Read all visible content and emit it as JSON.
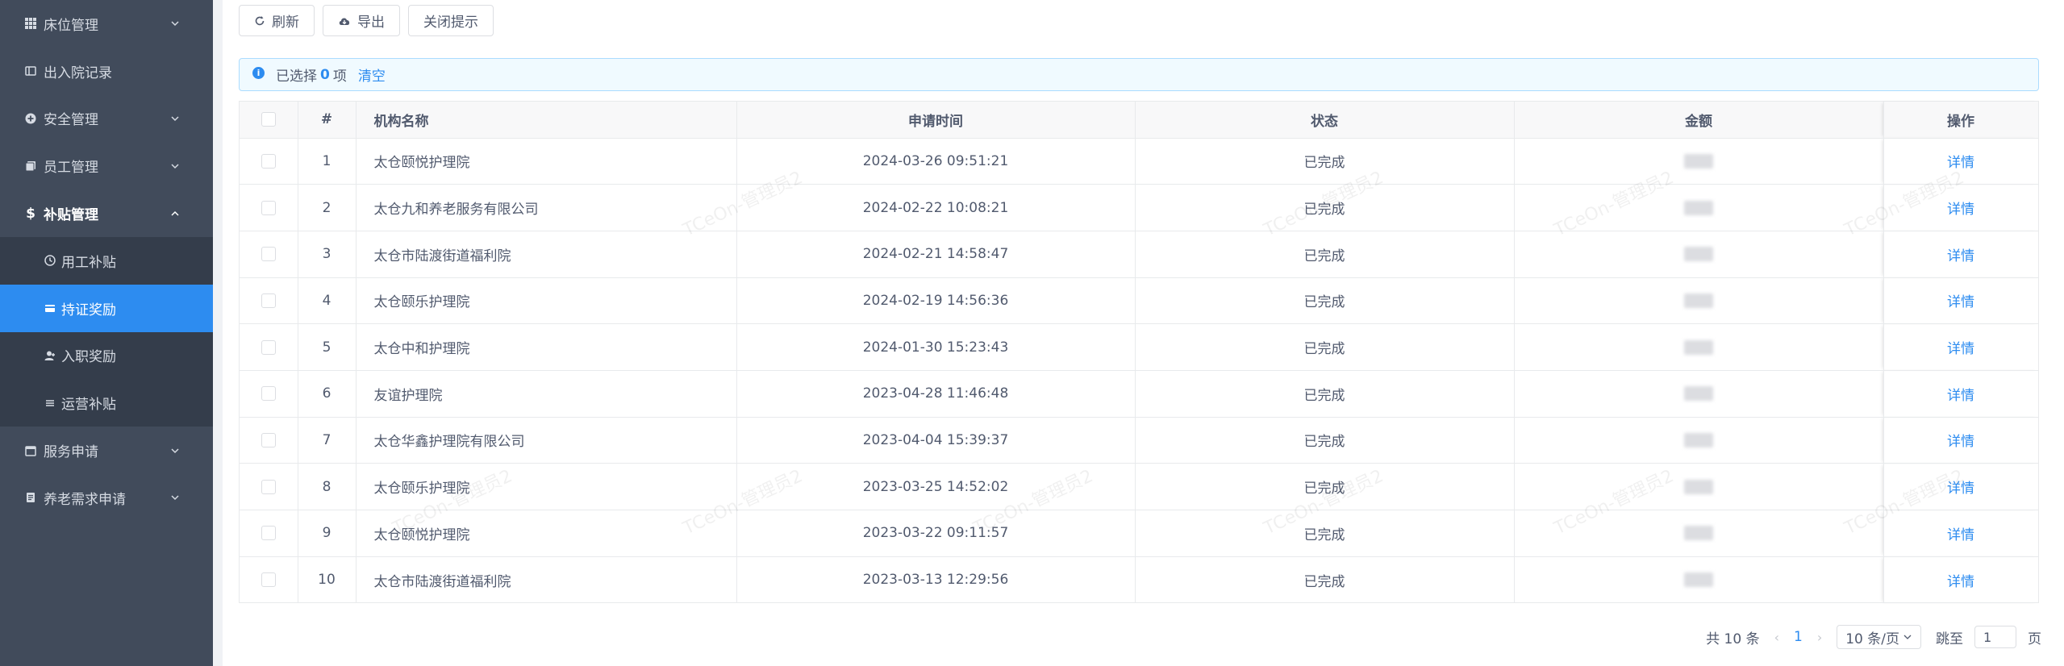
{
  "sidebar": {
    "items": [
      {
        "label": "床位管理",
        "icon": "grid-icon",
        "expandable": true
      },
      {
        "label": "出入院记录",
        "icon": "record-icon",
        "expandable": false
      },
      {
        "label": "安全管理",
        "icon": "shield-plus-icon",
        "expandable": true
      },
      {
        "label": "员工管理",
        "icon": "copy-icon",
        "expandable": true
      },
      {
        "label": "补贴管理",
        "icon": "dollar-icon",
        "expandable": true,
        "open": true
      },
      {
        "label": "服务申请",
        "icon": "calendar-icon",
        "expandable": true
      },
      {
        "label": "养老需求申请",
        "icon": "document-icon",
        "expandable": true
      }
    ],
    "subitems": [
      {
        "label": "用工补贴",
        "icon": "clock-icon"
      },
      {
        "label": "持证奖励",
        "icon": "card-icon",
        "active": true
      },
      {
        "label": "入职奖励",
        "icon": "user-add-icon"
      },
      {
        "label": "运营补贴",
        "icon": "list-icon"
      }
    ]
  },
  "toolbar": {
    "refresh": "刷新",
    "export": "导出",
    "close_tip": "关闭提示"
  },
  "alert": {
    "prefix": "已选择",
    "count": "0",
    "suffix": "项",
    "clear": "清空"
  },
  "table": {
    "headers": {
      "index": "#",
      "org": "机构名称",
      "time": "申请时间",
      "status": "状态",
      "amount": "金额",
      "ops": "操作"
    },
    "rows": [
      {
        "index": "1",
        "org": "太仓颐悦护理院",
        "time": "2024-03-26 09:51:21",
        "status": "已完成",
        "op": "详情"
      },
      {
        "index": "2",
        "org": "太仓九和养老服务有限公司",
        "time": "2024-02-22 10:08:21",
        "status": "已完成",
        "op": "详情"
      },
      {
        "index": "3",
        "org": "太仓市陆渡街道福利院",
        "time": "2024-02-21 14:58:47",
        "status": "已完成",
        "op": "详情"
      },
      {
        "index": "4",
        "org": "太仓颐乐护理院",
        "time": "2024-02-19 14:56:36",
        "status": "已完成",
        "op": "详情"
      },
      {
        "index": "5",
        "org": "太仓中和护理院",
        "time": "2024-01-30 15:23:43",
        "status": "已完成",
        "op": "详情"
      },
      {
        "index": "6",
        "org": "友谊护理院",
        "time": "2023-04-28 11:46:48",
        "status": "已完成",
        "op": "详情"
      },
      {
        "index": "7",
        "org": "太仓华鑫护理院有限公司",
        "time": "2023-04-04 15:39:37",
        "status": "已完成",
        "op": "详情"
      },
      {
        "index": "8",
        "org": "太仓颐乐护理院",
        "time": "2023-03-25 14:52:02",
        "status": "已完成",
        "op": "详情"
      },
      {
        "index": "9",
        "org": "太仓颐悦护理院",
        "time": "2023-03-22 09:11:57",
        "status": "已完成",
        "op": "详情"
      },
      {
        "index": "10",
        "org": "太仓市陆渡街道福利院",
        "time": "2023-03-13 12:29:56",
        "status": "已完成",
        "op": "详情"
      }
    ]
  },
  "pager": {
    "total": "共 10 条",
    "current": "1",
    "page_size": "10 条/页",
    "jump_label": "跳至",
    "jump_value": "1",
    "page_unit": "页"
  },
  "watermark": "TCeOn-管理员2",
  "colors": {
    "accent": "#2d8cf0",
    "sidebar": "#414b5b",
    "submenu": "#343d4b"
  }
}
